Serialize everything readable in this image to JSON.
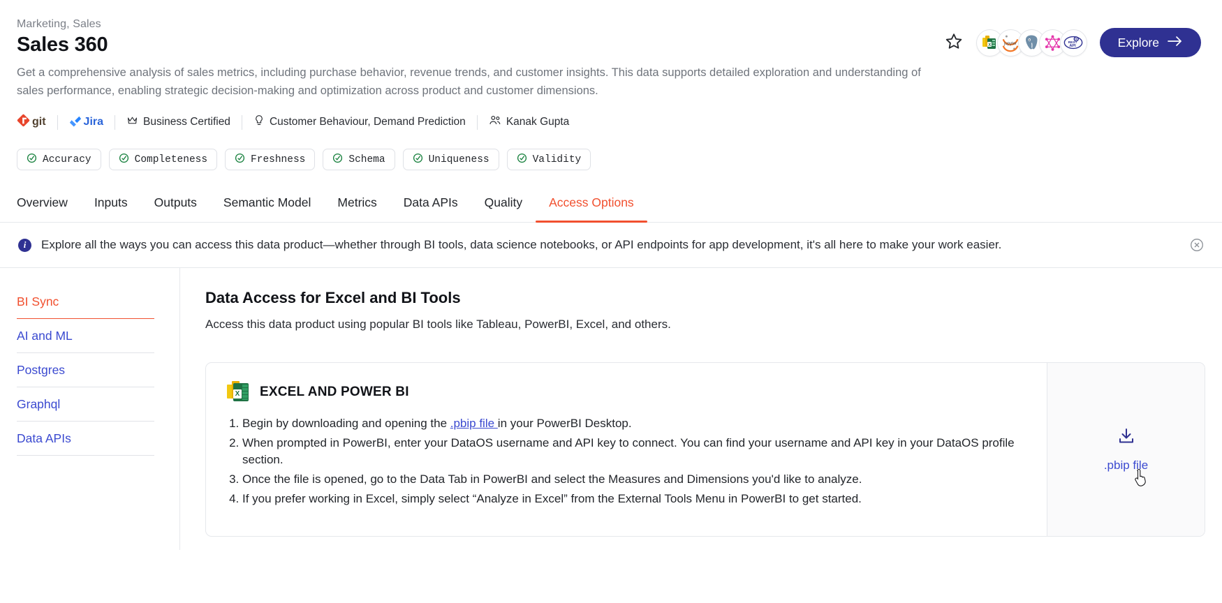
{
  "header": {
    "breadcrumb": "Marketing, Sales",
    "title": "Sales 360",
    "description": "Get a comprehensive analysis of sales metrics, including purchase behavior, revenue trends, and customer insights. This data supports detailed exploration and understanding of sales performance, enabling strategic decision-making and optimization across product and customer dimensions.",
    "explore_label": "Explore",
    "star_icon": "star-icon",
    "tool_icons": [
      {
        "name": "excel-powerbi-icon",
        "label": "Excel and Power BI"
      },
      {
        "name": "jupyter-icon",
        "label": "jupyter"
      },
      {
        "name": "postgres-icon",
        "label": "Postgres"
      },
      {
        "name": "graphql-icon",
        "label": "GraphQL"
      },
      {
        "name": "rest-api-icon",
        "label": "REST API"
      }
    ]
  },
  "meta": {
    "git_label": "git",
    "jira_label": "Jira",
    "certification": "Business Certified",
    "tags": "Customer Behaviour, Demand Prediction",
    "owner": "Kanak Gupta"
  },
  "quality_badges": [
    {
      "label": "Accuracy"
    },
    {
      "label": "Completeness"
    },
    {
      "label": "Freshness"
    },
    {
      "label": "Schema"
    },
    {
      "label": "Uniqueness"
    },
    {
      "label": "Validity"
    }
  ],
  "tabs": [
    {
      "label": "Overview",
      "active": false
    },
    {
      "label": "Inputs",
      "active": false
    },
    {
      "label": "Outputs",
      "active": false
    },
    {
      "label": "Semantic Model",
      "active": false
    },
    {
      "label": "Metrics",
      "active": false
    },
    {
      "label": "Data APIs",
      "active": false
    },
    {
      "label": "Quality",
      "active": false
    },
    {
      "label": "Access Options",
      "active": true
    }
  ],
  "banner": {
    "text": "Explore all the ways you can access this data product—whether through BI tools, data science notebooks, or API endpoints for app development, it's all here to make your work easier.",
    "info_icon": "info-icon",
    "close_icon": "close-icon"
  },
  "sidebar": {
    "items": [
      {
        "label": "BI Sync",
        "active": true
      },
      {
        "label": "AI and ML",
        "active": false
      },
      {
        "label": "Postgres",
        "active": false
      },
      {
        "label": "Graphql",
        "active": false
      },
      {
        "label": "Data APIs",
        "active": false
      }
    ]
  },
  "main": {
    "title": "Data Access for Excel and BI Tools",
    "subtitle": "Access this data product using popular BI tools like Tableau, PowerBI, Excel, and others.",
    "card": {
      "icon": "excel-powerbi-icon",
      "heading": "EXCEL AND POWER BI",
      "steps": [
        {
          "before": "Begin by downloading and opening the ",
          "link": ".pbip file ",
          "after": "in your PowerBI Desktop."
        },
        {
          "before": "When prompted in PowerBI, enter your DataOS username and API key to connect. You can find your username and API key in your DataOS profile section.",
          "link": "",
          "after": ""
        },
        {
          "before": "Once the file is opened, go to the Data Tab in PowerBI and select the Measures and Dimensions you'd like to analyze.",
          "link": "",
          "after": ""
        },
        {
          "before": "If you prefer working in Excel, simply select “Analyze in Excel” from the External Tools Menu in PowerBI to get started.",
          "link": "",
          "after": ""
        }
      ],
      "download_label": ".pbip file",
      "download_icon": "download-icon"
    }
  },
  "colors": {
    "accent_orange": "#f1502f",
    "link_blue": "#3b4ad0",
    "brand_indigo": "#2f3192",
    "quality_green": "#17803d",
    "muted_text": "#6f747c"
  }
}
